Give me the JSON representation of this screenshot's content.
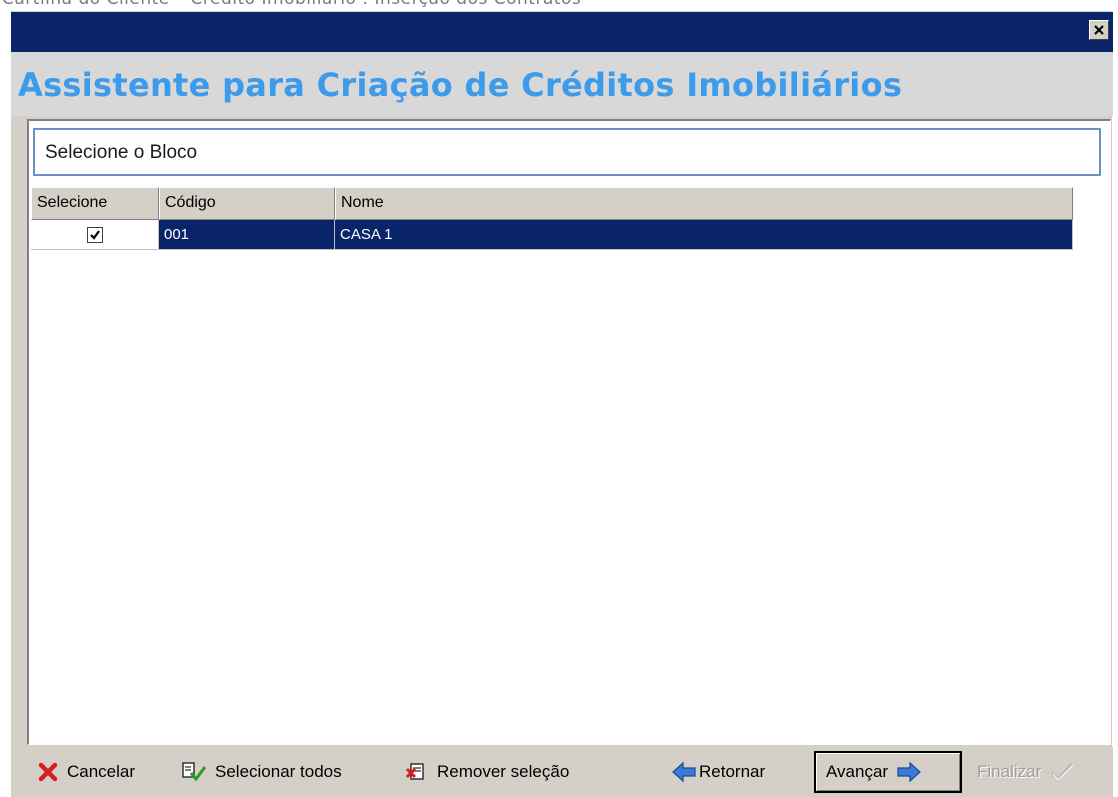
{
  "document": {
    "header_text": "Cartilha do Cliente – Crédito Imobiliário : Inserção dos Contratos"
  },
  "window": {
    "close_label": "×"
  },
  "wizard": {
    "title": "Assistente para Criação de Créditos Imobiliários",
    "step_label": "Selecione o Bloco",
    "title_color": "#3c9bea"
  },
  "grid": {
    "columns": [
      "Selecione",
      "Código",
      "Nome"
    ],
    "rows": [
      {
        "selected": true,
        "codigo": "001",
        "nome": "CASA 1"
      }
    ],
    "selection_color": "#0a246a"
  },
  "buttons": {
    "cancelar": "Cancelar",
    "selecionar_todos": "Selecionar todos",
    "remover_selecao": "Remover seleção",
    "retornar": "Retornar",
    "avancar": "Avançar",
    "finalizar": "Finalizar"
  },
  "icons": {
    "cancelar": "red-x-icon",
    "selecionar_todos": "select-all-check-icon",
    "remover_selecao": "remove-selection-icon",
    "retornar": "blue-left-arrow-icon",
    "avancar": "blue-right-arrow-icon",
    "finalizar": "check-icon"
  }
}
